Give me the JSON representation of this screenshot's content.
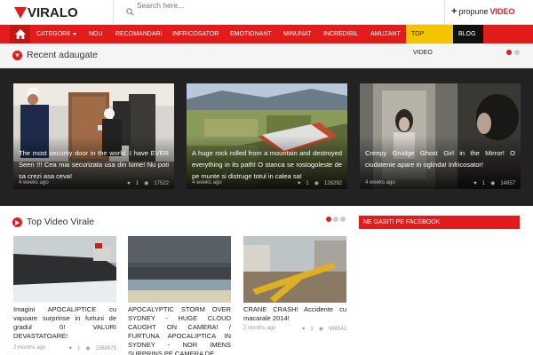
{
  "header": {
    "logo_text": "VIRALO",
    "search_placeholder": "Search here...",
    "propune_label": "propune",
    "propune_video": "VIDEO"
  },
  "nav": {
    "items": [
      {
        "label": "CATEGORII"
      },
      {
        "label": "NOU"
      },
      {
        "label": "RECOMANDARI"
      },
      {
        "label": "INFRICOSATOR"
      },
      {
        "label": "EMOTIONANT"
      },
      {
        "label": "MINUNAT"
      },
      {
        "label": "INCREDIBIL"
      },
      {
        "label": "AMUZANT"
      },
      {
        "label": "TOP"
      },
      {
        "label": "BLOG"
      }
    ],
    "video_sub": "VIDEO"
  },
  "recent": {
    "title": "Recent adaugate",
    "cards": [
      {
        "text": "The most security door in the world. I have EVER Seen !!! Cea mai securizata usa din lume! Nu poti sa crezi asa ceva!",
        "time": "4 weeks ago",
        "likes": "1",
        "views": "17522"
      },
      {
        "text": "A huge rock rolled from a mountain and destroyed everything in its path! O stanca se rostogoleste de pe munte si distruge totul in calea sa!",
        "time": "4 weeks ago",
        "likes": "1",
        "views": "126292"
      },
      {
        "text": "Creepy Grudge Ghost Girl in the Mirror! O ciudatenie apare in oglinda! Infricosator!",
        "time": "4 weeks ago",
        "likes": "1",
        "views": "14857"
      }
    ]
  },
  "top": {
    "title": "Top Video Virale",
    "items": [
      {
        "title": "Imagini APOCALIPTICE cu vapoare surprinse in furtuni de gradul 0! VALURI DEVASTATOARE!",
        "time": "2 months ago",
        "likes": "1",
        "views": "2368875"
      },
      {
        "title": "APOCALYPTIC STORM OVER SYDNEY - HUGE CLOUD CAUGHT ON CAMERA! / FURTUNA APOCALIPTICA IN SYDNEY - NOR IMENS SURPRINS PE CAMERA DE",
        "time": "",
        "likes": "",
        "views": ""
      },
      {
        "title": "CRANE CRASH! Accidente cu macarale 2014!",
        "time": "2 months ago",
        "likes": "1",
        "views": "948542"
      }
    ]
  },
  "facebook": {
    "title": "NE GASITI PE FACEBOOK"
  },
  "colors": {
    "accent": "#e21b1b",
    "top_tab": "#f5c400",
    "blog_tab": "#111111",
    "slider_bg": "#222222"
  },
  "icons": {
    "home": "home-icon",
    "search": "search-icon",
    "star": "star-icon",
    "heart": "heart-icon",
    "eye": "eye-icon"
  }
}
